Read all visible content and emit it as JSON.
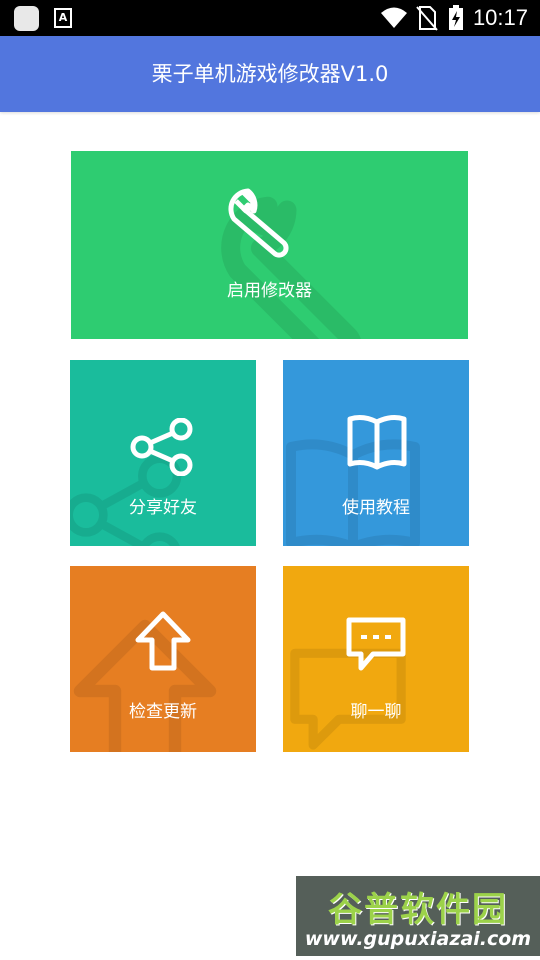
{
  "status_bar": {
    "time": "10:17",
    "icons": [
      "app-square-icon",
      "a-notification-icon",
      "wifi-icon",
      "no-sim-icon",
      "battery-charging-icon"
    ]
  },
  "app_bar": {
    "title": "栗子单机游戏修改器V1.0",
    "color": "#5276de"
  },
  "tiles": {
    "enable": {
      "label": "启用修改器",
      "icon": "wrench-icon",
      "color": "#2ecc71"
    },
    "share": {
      "label": "分享好友",
      "icon": "share-icon",
      "color": "#1abc9c"
    },
    "tutorial": {
      "label": "使用教程",
      "icon": "book-icon",
      "color": "#3498db"
    },
    "update": {
      "label": "检查更新",
      "icon": "arrow-up-icon",
      "color": "#e67e22"
    },
    "chat": {
      "label": "聊一聊",
      "icon": "chat-bubble-icon",
      "color": "#f1a80f"
    }
  },
  "watermark": {
    "title": "谷普软件园",
    "url": "www.gupuxiazai.com"
  }
}
